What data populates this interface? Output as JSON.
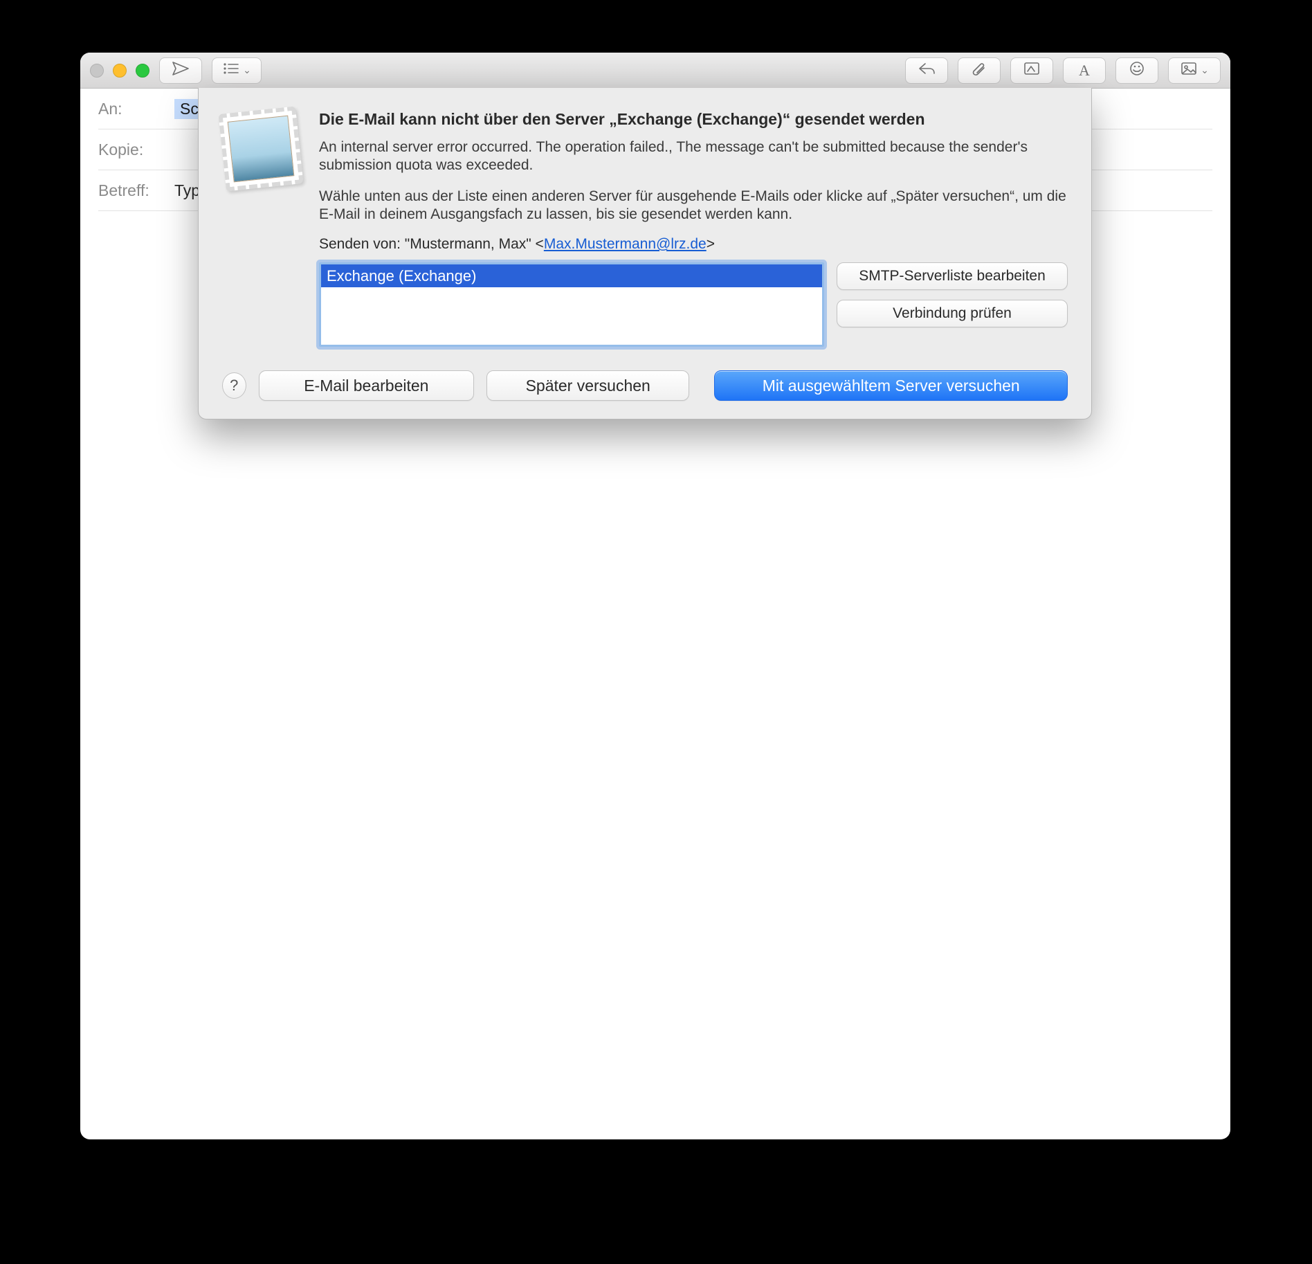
{
  "toolbar": {
    "icons": {
      "send": "send-icon",
      "list": "list-icon",
      "reply": "reply-icon",
      "attach": "paperclip-icon",
      "markup": "markup-icon",
      "font": "font-icon",
      "emoji": "emoji-icon",
      "media": "photo-icon"
    }
  },
  "compose": {
    "to_label": "An:",
    "to_value": "Schnup",
    "cc_label": "Kopie:",
    "subject_label": "Betreff:",
    "subject_value": "Typ"
  },
  "sheet": {
    "title": "Die E-Mail kann nicht über den Server „Exchange (Exchange)“ gesendet werden",
    "error_text": "An internal server error occurred. The operation failed., The message can't be submitted because the sender's submission quota was exceeded.",
    "instruction_text": "Wähle unten aus der Liste einen anderen Server für ausgehende E-Mails oder klicke auf „Später versuchen“, um die E-Mail in deinem Ausgangsfach zu lassen, bis sie gesendet werden kann.",
    "send_from_prefix": "Senden von: \"Mustermann, Max\" <",
    "send_from_email": "Max.Mustermann@lrz.de",
    "send_from_suffix": ">",
    "server_list": [
      "Exchange (Exchange)"
    ],
    "edit_smtp_label": "SMTP-Serverliste bearbeiten",
    "check_conn_label": "Verbindung prüfen",
    "help_label": "?",
    "edit_mail_label": "E-Mail bearbeiten",
    "try_later_label": "Später versuchen",
    "try_server_label": "Mit ausgewähltem Server versuchen"
  }
}
